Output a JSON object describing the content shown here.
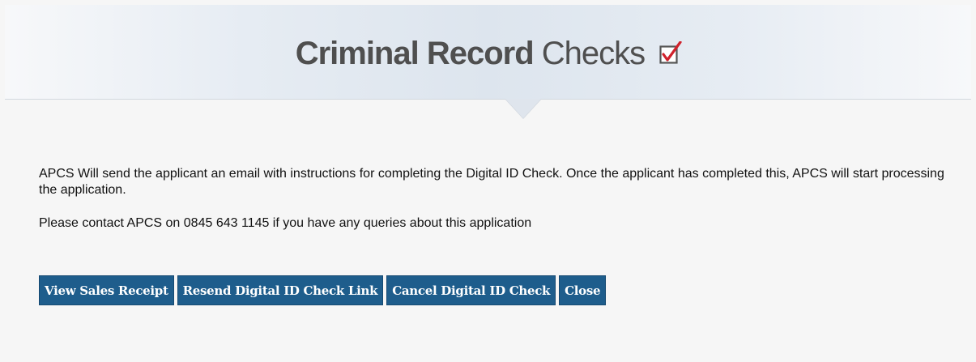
{
  "header": {
    "title_strong": "Criminal Record",
    "title_light": "Checks",
    "icon": "checkbox-tick-icon"
  },
  "message": {
    "line1": "APCS Will send the applicant an email with instructions for completing the Digital ID Check. Once the applicant has completed this, APCS will start processing the application.",
    "line2": "Please contact APCS on 0845 643 1145 if you have any queries about this application"
  },
  "actions": {
    "view_receipt": "View Sales Receipt",
    "resend_link": "Resend Digital ID Check Link",
    "cancel_check": "Cancel Digital ID Check",
    "close": "Close"
  },
  "colors": {
    "button_bg": "#1e5d8c",
    "tick": "#d0212b"
  }
}
